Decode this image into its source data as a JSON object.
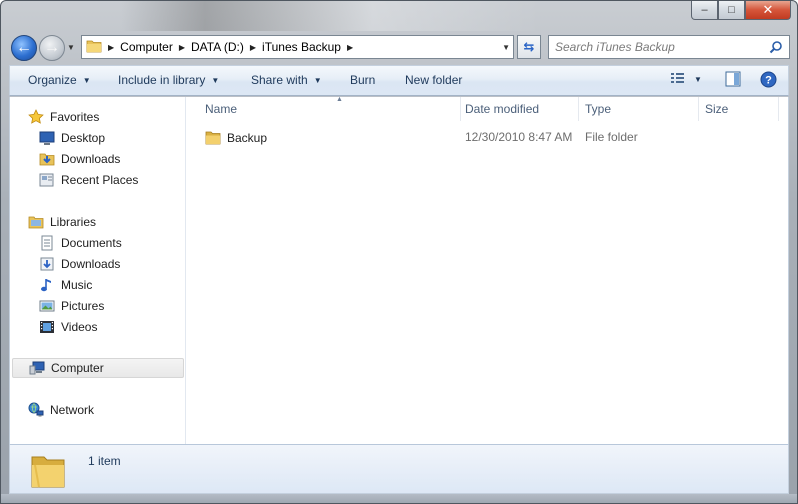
{
  "window": {
    "caption": {
      "minimize": "‒",
      "maximize": "□",
      "close": "✕"
    }
  },
  "address": {
    "crumbs": [
      "Computer",
      "DATA (D:)",
      "iTunes Backup"
    ]
  },
  "search": {
    "placeholder": "Search iTunes Backup"
  },
  "toolbar": {
    "organize": "Organize",
    "include_in_library": "Include in library",
    "share_with": "Share with",
    "burn": "Burn",
    "new_folder": "New folder"
  },
  "nav": {
    "favorites": "Favorites",
    "favorites_items": [
      "Desktop",
      "Downloads",
      "Recent Places"
    ],
    "libraries": "Libraries",
    "libraries_items": [
      "Documents",
      "Downloads",
      "Music",
      "Pictures",
      "Videos"
    ],
    "computer": "Computer",
    "network": "Network"
  },
  "files": {
    "columns": {
      "name": "Name",
      "date_modified": "Date modified",
      "type": "Type",
      "size": "Size"
    },
    "rows": [
      {
        "name": "Backup",
        "date_modified": "12/30/2010 8:47 AM",
        "type": "File folder",
        "size": ""
      }
    ]
  },
  "details": {
    "count": "1 item"
  },
  "icons": {
    "folder": "folder-icon",
    "star": "star-icon",
    "desktop": "desktop-icon",
    "downloads": "downloads-icon",
    "recent": "recent-places-icon",
    "library": "library-icon",
    "documents": "documents-icon",
    "music": "music-icon",
    "pictures": "pictures-icon",
    "videos": "videos-icon",
    "computer": "computer-icon",
    "network": "network-icon"
  },
  "colors": {
    "accent": "#2d6fd0",
    "toolbar_text": "#1e395b",
    "header_text": "#4c607a"
  }
}
